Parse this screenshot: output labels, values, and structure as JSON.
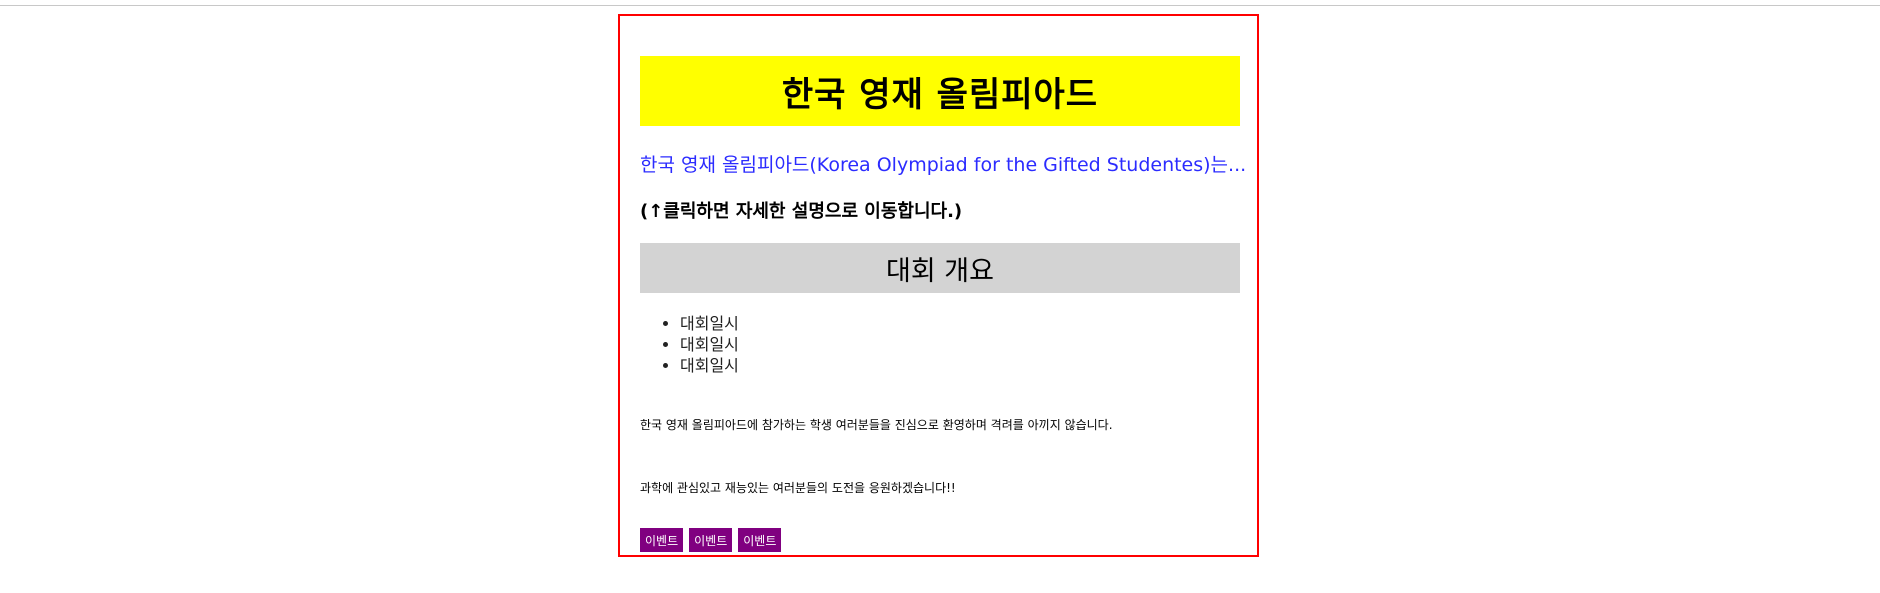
{
  "header": {
    "title": "한국 영재 올림피아드"
  },
  "intro": {
    "link_text": "한국 영재 올림피아드(Korea Olympiad for the Gifted Studentes)는...",
    "hint": "(↑클릭하면 자세한 설명으로 이동합니다.)"
  },
  "overview": {
    "heading": "대회 개요",
    "items": [
      "대회일시",
      "대회일시",
      "대회일시"
    ]
  },
  "messages": {
    "welcome": "한국 영재 올림피아드에 참가하는 학생 여러분들을 진심으로 환영하며 격려를 아끼지 않습니다.",
    "cheer": "과학에 관심있고 재능있는 여러분들의 도전을 응원하겠습니다!!"
  },
  "buttons": [
    "이벤트",
    "이벤트",
    "이벤트"
  ],
  "colors": {
    "frame_border": "#ff0000",
    "title_bg": "#ffff00",
    "section_bg": "#d3d3d3",
    "link": "#2b2bff",
    "button_bg": "#800080"
  }
}
